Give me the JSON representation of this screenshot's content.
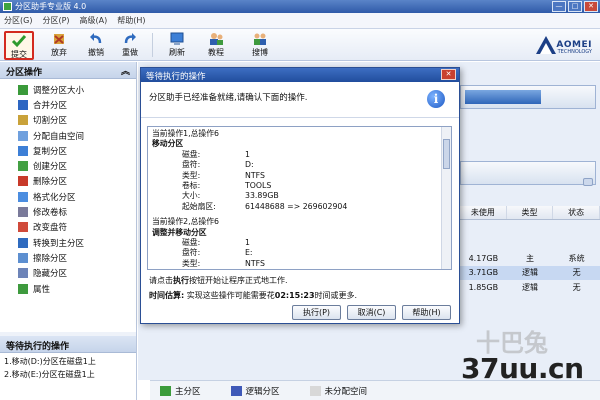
{
  "window": {
    "title": "分区助手专业版 4.0",
    "controls": [
      "—",
      "□",
      "✕"
    ]
  },
  "menu": [
    "分区(G)",
    "分区(P)",
    "高级(A)",
    "帮助(H)"
  ],
  "toolbar": {
    "buttons": [
      {
        "label": "提交",
        "icon": "check-icon",
        "active": true
      },
      {
        "label": "放弃",
        "icon": "discard-icon"
      },
      {
        "label": "撤销",
        "icon": "undo-icon"
      },
      {
        "label": "重做",
        "icon": "redo-icon"
      },
      {
        "label": "刷新",
        "icon": "refresh-icon"
      },
      {
        "label": "教程",
        "icon": "tutorial-icon"
      },
      {
        "label": "搜博",
        "icon": "search-people-icon"
      }
    ],
    "logo": {
      "brand": "AOMEI",
      "sub": "TECHNOLOGY"
    }
  },
  "left_panel": {
    "title": "分区操作",
    "collapse": "︽",
    "operations": [
      "调整分区大小",
      "合并分区",
      "切割分区",
      "分配自由空间",
      "复制分区",
      "创建分区",
      "删除分区",
      "格式化分区",
      "修改卷标",
      "改变盘符",
      "转换到主分区",
      "擦除分区",
      "隐藏分区",
      "属性"
    ],
    "pending_title": "等待执行的操作",
    "pending": [
      "1.移动(D:)分区在磁盘1上",
      "2.移动(E:)分区在磁盘1上"
    ]
  },
  "table": {
    "headers": [
      "未使用",
      "类型",
      "状态"
    ],
    "rows": [
      {
        "free": "4.17GB",
        "type": "主",
        "status": "系统"
      },
      {
        "free": "3.71GB",
        "type": "逻辑",
        "status": "无"
      },
      {
        "free": "1.85GB",
        "type": "逻辑",
        "status": "无"
      }
    ]
  },
  "disk_bars": [
    {
      "fill": 0.6
    },
    {
      "fill": 0
    }
  ],
  "legend": [
    {
      "label": "主分区",
      "color": "#3c9c3c"
    },
    {
      "label": "逻辑分区",
      "color": "#3f59b8"
    },
    {
      "label": "未分配空间",
      "color": "#d8d8d8"
    }
  ],
  "dialog": {
    "title": "等待执行的操作",
    "info": "分区助手已经准备就绪,请确认下面的操作.",
    "op1": {
      "header": "当前操作1,总操作6",
      "name": "移动分区",
      "fields": [
        {
          "k": "磁盘:",
          "v": "1"
        },
        {
          "k": "盘符:",
          "v": "D:"
        },
        {
          "k": "类型:",
          "v": "NTFS"
        },
        {
          "k": "卷标:",
          "v": "TOOLS"
        },
        {
          "k": "大小:",
          "v": "33.89GB"
        },
        {
          "k": "起始扇区:",
          "v": "61448688 => 269602904"
        }
      ]
    },
    "op2": {
      "header": "当前操作2,总操作6",
      "name": "调整并移动分区",
      "fields": [
        {
          "k": "磁盘:",
          "v": "1"
        },
        {
          "k": "盘符:",
          "v": "E:"
        },
        {
          "k": "类型:",
          "v": "NTFS"
        }
      ]
    },
    "hint_pre": "请点击",
    "hint_bold": "执行",
    "hint_post": "按钮开始让程序正式地工作.",
    "time_label": "时间估算:",
    "time_pre": "实现这些操作可能需要花",
    "time_value": "02:15:23",
    "time_post": "时间或更多.",
    "buttons": [
      "执行(P)",
      "取消(C)",
      "帮助(H)"
    ]
  },
  "watermark": "37uu.cn"
}
